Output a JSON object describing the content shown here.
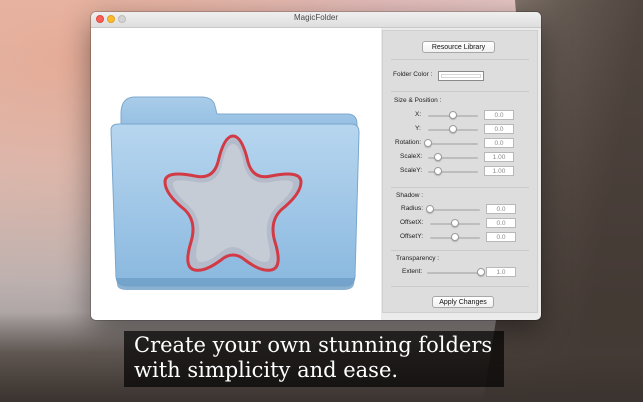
{
  "window": {
    "title": "MagicFolder"
  },
  "panel": {
    "resource_library_label": "Resource Library",
    "folder_color_label": "Folder Color :",
    "size_position": {
      "heading": "Size & Position :",
      "fields": [
        {
          "label": "X:",
          "value": "0.0",
          "level": 0.5
        },
        {
          "label": "Y:",
          "value": "0.0",
          "level": 0.5
        },
        {
          "label": "Rotation:",
          "value": "0.0",
          "level": 0.0
        },
        {
          "label": "ScaleX:",
          "value": "1.00",
          "level": 0.2
        },
        {
          "label": "ScaleY:",
          "value": "1.00",
          "level": 0.2
        }
      ]
    },
    "shadow": {
      "heading": "Shadow :",
      "fields": [
        {
          "label": "Radius:",
          "value": "0.0",
          "level": 0.0
        },
        {
          "label": "OffsetX:",
          "value": "0.0",
          "level": 0.5
        },
        {
          "label": "OffsetY:",
          "value": "0.0",
          "level": 0.5
        }
      ]
    },
    "transparency": {
      "heading": "Transparency :",
      "fields": [
        {
          "label": "Extent:",
          "value": "1.0",
          "level": 1.0
        }
      ]
    },
    "apply_label": "Apply Changes"
  },
  "caption": {
    "line1": "Create your own stunning folders",
    "line2": "with simplicity and ease."
  },
  "colors": {
    "folder_blue": "#9cc3e3",
    "star_outline": "#d23a45",
    "close": "#fc5f57",
    "minimize": "#fdbb2e"
  }
}
